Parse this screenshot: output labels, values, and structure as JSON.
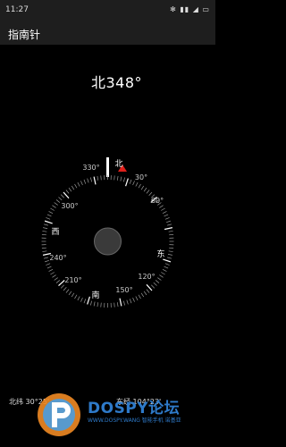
{
  "status_bar": {
    "time": "11:27",
    "icons_text": "✻ ▮▮ ◢ ▭"
  },
  "app_bar": {
    "title": "指南针"
  },
  "compass": {
    "direction_char": "北",
    "heading_degrees": "348°",
    "heading_value": 348,
    "degree_labels": [
      "330°",
      "30°",
      "60°",
      "120°",
      "150°",
      "210°",
      "240°",
      "300°"
    ],
    "cardinal_labels": {
      "north": "北",
      "east": "东",
      "south": "南",
      "west": "西"
    },
    "indicator_color": "#e0201b"
  },
  "footer": {
    "latitude_label": "北纬",
    "latitude_value": "30°25'",
    "longitude_label": "东经",
    "longitude_value": "104°23'"
  },
  "watermark": {
    "brand": "DOSPY论坛",
    "sub_text": "WWW.DOSPY.WANG  智能手机  诺基亚"
  }
}
